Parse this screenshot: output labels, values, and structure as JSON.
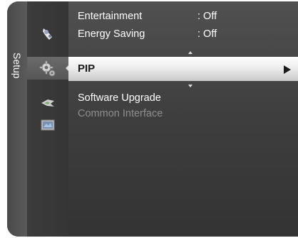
{
  "sidebar": {
    "label": "Setup",
    "icons": [
      "picture-icon",
      "setup-gear-icon",
      "input-icon",
      "application-icon"
    ]
  },
  "menu": {
    "items": [
      {
        "label": "Entertainment",
        "value": ": Off",
        "enabled": true
      },
      {
        "label": "Energy Saving",
        "value": ": Off",
        "enabled": true
      },
      {
        "label": "PIP",
        "value": "",
        "enabled": true,
        "selected": true
      },
      {
        "label": "Software Upgrade",
        "value": "",
        "enabled": true
      },
      {
        "label": "Common Interface",
        "value": "",
        "enabled": false
      }
    ]
  },
  "colors": {
    "background": "#3e3e3e",
    "selected_bar": "#eeeeee",
    "disabled_text": "#8e8e8e",
    "text": "#ffffff"
  }
}
